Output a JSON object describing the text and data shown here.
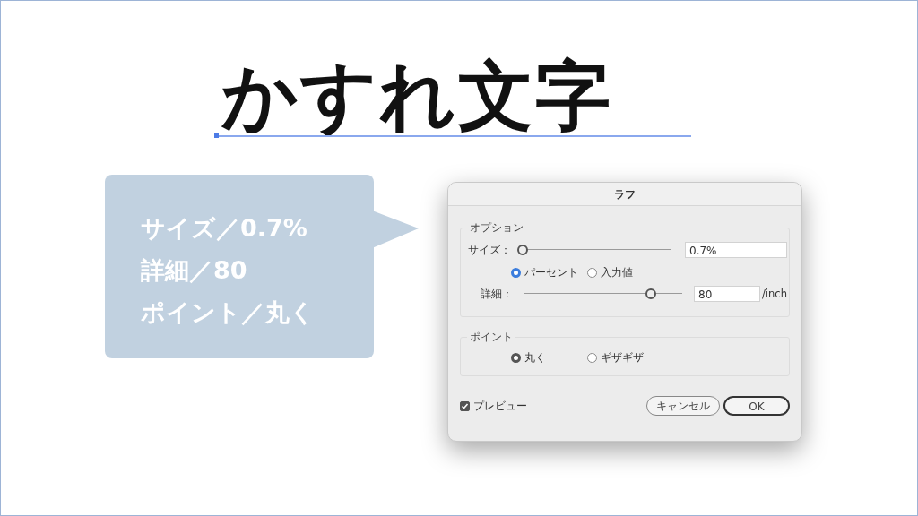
{
  "headline": "かすれ文字",
  "callout": {
    "lines": [
      "サイズ／0.7%",
      "詳細／80",
      "ポイント／丸く"
    ]
  },
  "dialog": {
    "title": "ラフ",
    "options": {
      "label": "オプション",
      "size": {
        "label": "サイズ：",
        "level": 0,
        "value": "0.7%"
      },
      "units": [
        {
          "label": "パーセント",
          "selected": true
        },
        {
          "label": "入力値",
          "selected": false
        }
      ],
      "detail": {
        "label": "詳細：",
        "level": 0.8,
        "value": "80",
        "unit": "/inch"
      }
    },
    "points": {
      "label": "ポイント",
      "choices": [
        {
          "label": "丸く",
          "selected": true
        },
        {
          "label": "ギザギザ",
          "selected": false
        }
      ]
    },
    "preview": {
      "label": "プレビュー",
      "checked": true
    },
    "buttons": [
      {
        "label": "キャンセル",
        "kind": "secondary"
      },
      {
        "label": "OK",
        "kind": "default"
      }
    ]
  }
}
